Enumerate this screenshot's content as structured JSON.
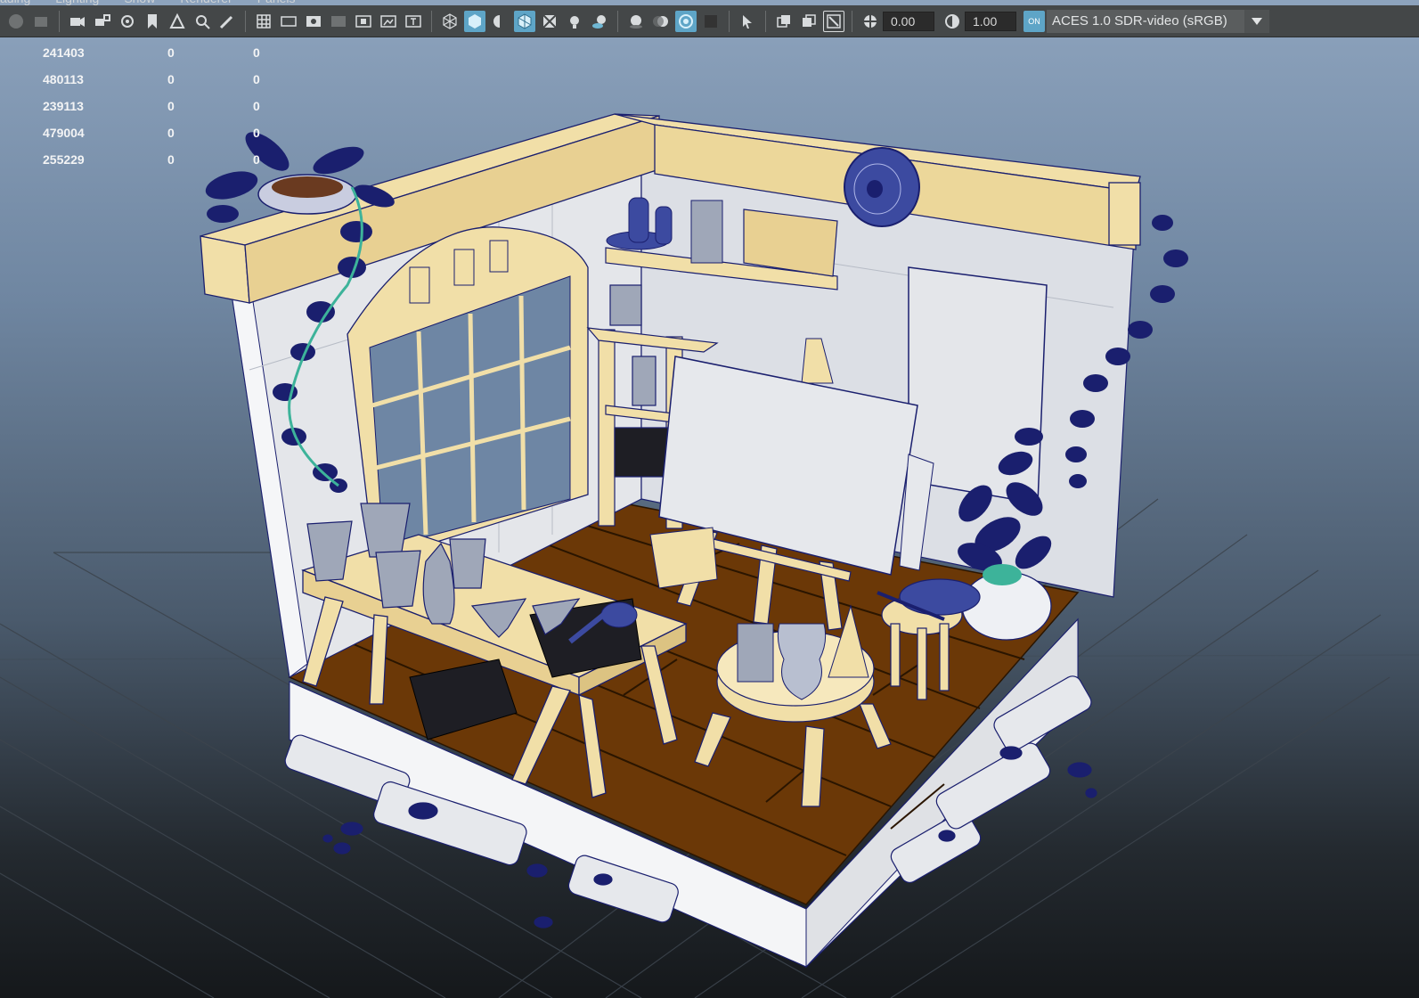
{
  "menu": {
    "items": [
      "ading",
      "Lighting",
      "Show",
      "Renderer",
      "Panels"
    ]
  },
  "toolbar": {
    "exposure_value": "0.00",
    "gamma_value": "1.00",
    "on_label": "ON",
    "color_space": "ACES 1.0 SDR-video (sRGB)",
    "icons": [
      "camera-icon",
      "camera-lock-icon",
      "camera-attributes-icon",
      "bookmark-icon",
      "image-plane-icon",
      "2d-pan-zoom-icon",
      "grease-pencil-icon",
      "grid-icon",
      "film-gate-icon",
      "resolution-gate-icon",
      "gate-mask-icon",
      "field-chart-icon",
      "safe-action-icon",
      "safe-title-icon",
      "wireframe-icon",
      "smooth-shade-icon",
      "default-material-icon",
      "wireframe-on-shaded-icon",
      "textured-icon",
      "use-lights-icon",
      "shadows-icon",
      "screen-space-ao-icon",
      "motion-blur-icon",
      "anti-aliasing-icon",
      "depth-of-field-icon",
      "isolate-select-icon",
      "xray-icon",
      "xray-joints-icon",
      "xray-active-icon",
      "exposure-icon",
      "gamma-icon",
      "color-management-icon"
    ]
  },
  "hud": {
    "rows": [
      [
        "241403",
        "0",
        "0"
      ],
      [
        "480113",
        "0",
        "0"
      ],
      [
        "239113",
        "0",
        "0"
      ],
      [
        "479004",
        "0",
        "0"
      ],
      [
        "255229",
        "0",
        "0"
      ]
    ]
  },
  "colors": {
    "wood_light": "#f1dfa8",
    "floor": "#6b3807",
    "wall": "#e4e6ea",
    "wire": "#1a1f6e",
    "accent": "#5ea5c7"
  }
}
